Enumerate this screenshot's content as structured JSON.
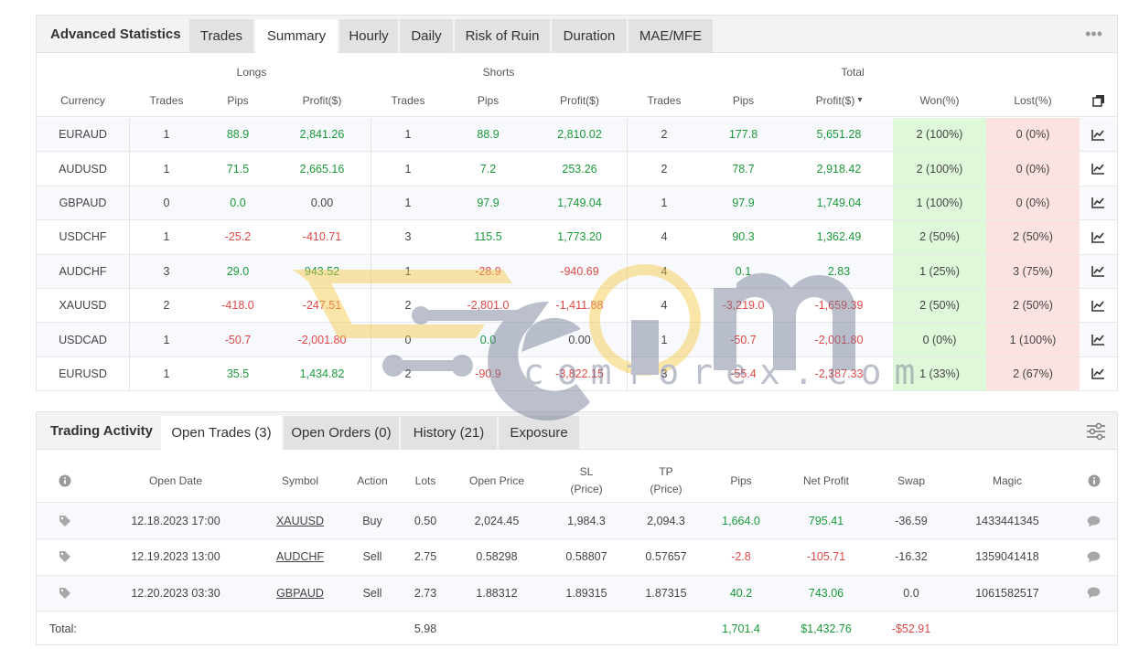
{
  "stats": {
    "title": "Advanced Statistics",
    "tabs": [
      {
        "label": "Trades",
        "active": false
      },
      {
        "label": "Summary",
        "active": true
      },
      {
        "label": "Hourly",
        "active": false
      },
      {
        "label": "Daily",
        "active": false
      },
      {
        "label": "Risk of Ruin",
        "active": false
      },
      {
        "label": "Duration",
        "active": false
      },
      {
        "label": "MAE/MFE",
        "active": false
      }
    ],
    "menu_icon": "more-dots-icon",
    "group_headers": {
      "longs": "Longs",
      "shorts": "Shorts",
      "total": "Total"
    },
    "columns": {
      "currency": "Currency",
      "long_trades": "Trades",
      "long_pips": "Pips",
      "long_profit": "Profit($)",
      "short_trades": "Trades",
      "short_pips": "Pips",
      "short_profit": "Profit($)",
      "total_trades": "Trades",
      "total_pips": "Pips",
      "total_profit": "Profit($)",
      "sort_indicator": "▾",
      "won": "Won(%)",
      "lost": "Lost(%)"
    },
    "copy_icon": "copy-icon",
    "rows": [
      {
        "currency": "EURAUD",
        "long_trades": "1",
        "long_pips": "88.9",
        "long_profit": "2,841.26",
        "short_trades": "1",
        "short_pips": "88.9",
        "short_profit": "2,810.02",
        "total_trades": "2",
        "total_pips": "177.8",
        "total_profit": "5,651.28",
        "won": "2 (100%)",
        "lost": "0 (0%)"
      },
      {
        "currency": "AUDUSD",
        "long_trades": "1",
        "long_pips": "71.5",
        "long_profit": "2,665.16",
        "short_trades": "1",
        "short_pips": "7.2",
        "short_profit": "253.26",
        "total_trades": "2",
        "total_pips": "78.7",
        "total_profit": "2,918.42",
        "won": "2 (100%)",
        "lost": "0 (0%)"
      },
      {
        "currency": "GBPAUD",
        "long_trades": "0",
        "long_pips": "0.0",
        "long_profit": "0.00",
        "short_trades": "1",
        "short_pips": "97.9",
        "short_profit": "1,749.04",
        "total_trades": "1",
        "total_pips": "97.9",
        "total_profit": "1,749.04",
        "won": "1 (100%)",
        "lost": "0 (0%)"
      },
      {
        "currency": "USDCHF",
        "long_trades": "1",
        "long_pips": "-25.2",
        "long_profit": "-410.71",
        "short_trades": "3",
        "short_pips": "115.5",
        "short_profit": "1,773.20",
        "total_trades": "4",
        "total_pips": "90.3",
        "total_profit": "1,362.49",
        "won": "2 (50%)",
        "lost": "2 (50%)"
      },
      {
        "currency": "AUDCHF",
        "long_trades": "3",
        "long_pips": "29.0",
        "long_profit": "943.52",
        "short_trades": "1",
        "short_pips": "-28.9",
        "short_profit": "-940.69",
        "total_trades": "4",
        "total_pips": "0.1",
        "total_profit": "2.83",
        "won": "1 (25%)",
        "lost": "3 (75%)"
      },
      {
        "currency": "XAUUSD",
        "long_trades": "2",
        "long_pips": "-418.0",
        "long_profit": "-247.51",
        "short_trades": "2",
        "short_pips": "-2,801.0",
        "short_profit": "-1,411.88",
        "total_trades": "4",
        "total_pips": "-3,219.0",
        "total_profit": "-1,659.39",
        "won": "2 (50%)",
        "lost": "2 (50%)"
      },
      {
        "currency": "USDCAD",
        "long_trades": "1",
        "long_pips": "-50.7",
        "long_profit": "-2,001.80",
        "short_trades": "0",
        "short_pips": "0.0",
        "short_profit": "0.00",
        "total_trades": "1",
        "total_pips": "-50.7",
        "total_profit": "-2,001.80",
        "won": "0 (0%)",
        "lost": "1 (100%)"
      },
      {
        "currency": "EURUSD",
        "long_trades": "1",
        "long_pips": "35.5",
        "long_profit": "1,434.82",
        "short_trades": "2",
        "short_pips": "-90.9",
        "short_profit": "-3,822.15",
        "total_trades": "3",
        "total_pips": "-55.4",
        "total_profit": "-2,387.33",
        "won": "1 (33%)",
        "lost": "2 (67%)"
      }
    ]
  },
  "activity": {
    "title": "Trading Activity",
    "tabs": [
      {
        "label": "Open Trades (3)",
        "active": true
      },
      {
        "label": "Open Orders (0)",
        "active": false
      },
      {
        "label": "History (21)",
        "active": false
      },
      {
        "label": "Exposure",
        "active": false
      }
    ],
    "filter_icon": "sliders-icon",
    "columns": {
      "open_date": "Open Date",
      "symbol": "Symbol",
      "action": "Action",
      "lots": "Lots",
      "open_price": "Open Price",
      "sl_1": "SL",
      "sl_2": "(Price)",
      "tp_1": "TP",
      "tp_2": "(Price)",
      "pips": "Pips",
      "net_profit": "Net Profit",
      "swap": "Swap",
      "magic": "Magic"
    },
    "rows": [
      {
        "open_date": "12.18.2023 17:00",
        "symbol": "XAUUSD",
        "action": "Buy",
        "lots": "0.50",
        "open_price": "2,024.45",
        "sl": "1,984.3",
        "tp": "2,094.3",
        "pips": "1,664.0",
        "net_profit": "795.41",
        "swap": "-36.59",
        "magic": "1433441345"
      },
      {
        "open_date": "12.19.2023 13:00",
        "symbol": "AUDCHF",
        "action": "Sell",
        "lots": "2.75",
        "open_price": "0.58298",
        "sl": "0.58807",
        "tp": "0.57657",
        "pips": "-2.8",
        "net_profit": "-105.71",
        "swap": "-16.32",
        "magic": "1359041418"
      },
      {
        "open_date": "12.20.2023 03:30",
        "symbol": "GBPAUD",
        "action": "Sell",
        "lots": "2.73",
        "open_price": "1.88312",
        "sl": "1.89315",
        "tp": "1.87315",
        "pips": "40.2",
        "net_profit": "743.06",
        "swap": "0.0",
        "magic": "1061582517"
      }
    ],
    "total": {
      "label": "Total:",
      "lots": "5.98",
      "pips": "1,701.4",
      "net_profit": "$1,432.76",
      "swap": "-$52.91"
    }
  },
  "watermark": {
    "text": "ecomforex.com",
    "icon": "ecom-logo-icon"
  },
  "colors": {
    "positive": "#1a9a3a",
    "negative": "#e04848",
    "won_bg": "#dff8da",
    "lost_bg": "#fde2e2",
    "header_bg": "#f3f3f3",
    "tab_bg": "#e2e2e2"
  }
}
